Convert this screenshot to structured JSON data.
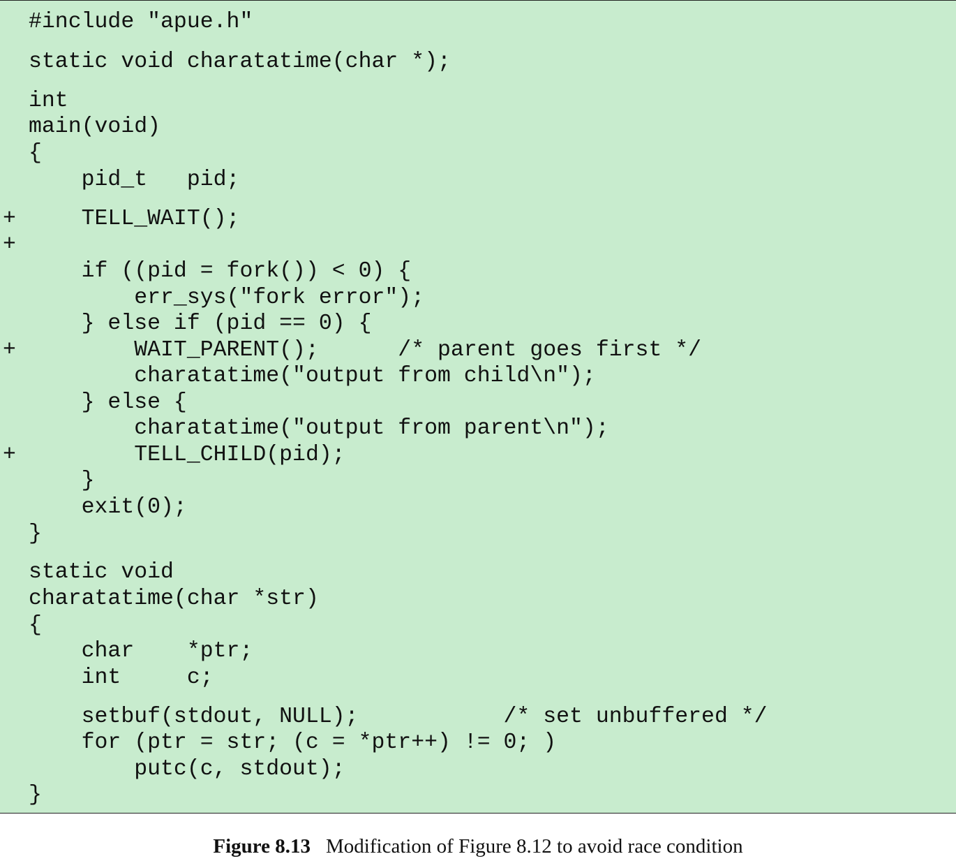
{
  "code": {
    "lines": [
      {
        "marker": "",
        "text": "#include \"apue.h\""
      },
      {
        "marker": "",
        "text": "static void charatatime(char *);"
      },
      {
        "marker": "",
        "text": "int"
      },
      {
        "marker": "",
        "text": "main(void)"
      },
      {
        "marker": "",
        "text": "{"
      },
      {
        "marker": "",
        "text": "    pid_t   pid;"
      },
      {
        "marker": "+",
        "text": "    TELL_WAIT();"
      },
      {
        "marker": "+",
        "text": ""
      },
      {
        "marker": "",
        "text": "    if ((pid = fork()) < 0) {"
      },
      {
        "marker": "",
        "text": "        err_sys(\"fork error\");"
      },
      {
        "marker": "",
        "text": "    } else if (pid == 0) {"
      },
      {
        "marker": "+",
        "text": "        WAIT_PARENT();      /* parent goes first */"
      },
      {
        "marker": "",
        "text": "        charatatime(\"output from child\\n\");"
      },
      {
        "marker": "",
        "text": "    } else {"
      },
      {
        "marker": "",
        "text": "        charatatime(\"output from parent\\n\");"
      },
      {
        "marker": "+",
        "text": "        TELL_CHILD(pid);"
      },
      {
        "marker": "",
        "text": "    }"
      },
      {
        "marker": "",
        "text": "    exit(0);"
      },
      {
        "marker": "",
        "text": "}"
      },
      {
        "marker": "",
        "text": "static void"
      },
      {
        "marker": "",
        "text": "charatatime(char *str)"
      },
      {
        "marker": "",
        "text": "{"
      },
      {
        "marker": "",
        "text": "    char    *ptr;"
      },
      {
        "marker": "",
        "text": "    int     c;"
      },
      {
        "marker": "",
        "text": "    setbuf(stdout, NULL);           /* set unbuffered */"
      },
      {
        "marker": "",
        "text": "    for (ptr = str; (c = *ptr++) != 0; )"
      },
      {
        "marker": "",
        "text": "        putc(c, stdout);"
      },
      {
        "marker": "",
        "text": "}"
      }
    ]
  },
  "caption": {
    "label": "Figure 8.13",
    "text": "Modification of Figure 8.12 to avoid race condition"
  }
}
